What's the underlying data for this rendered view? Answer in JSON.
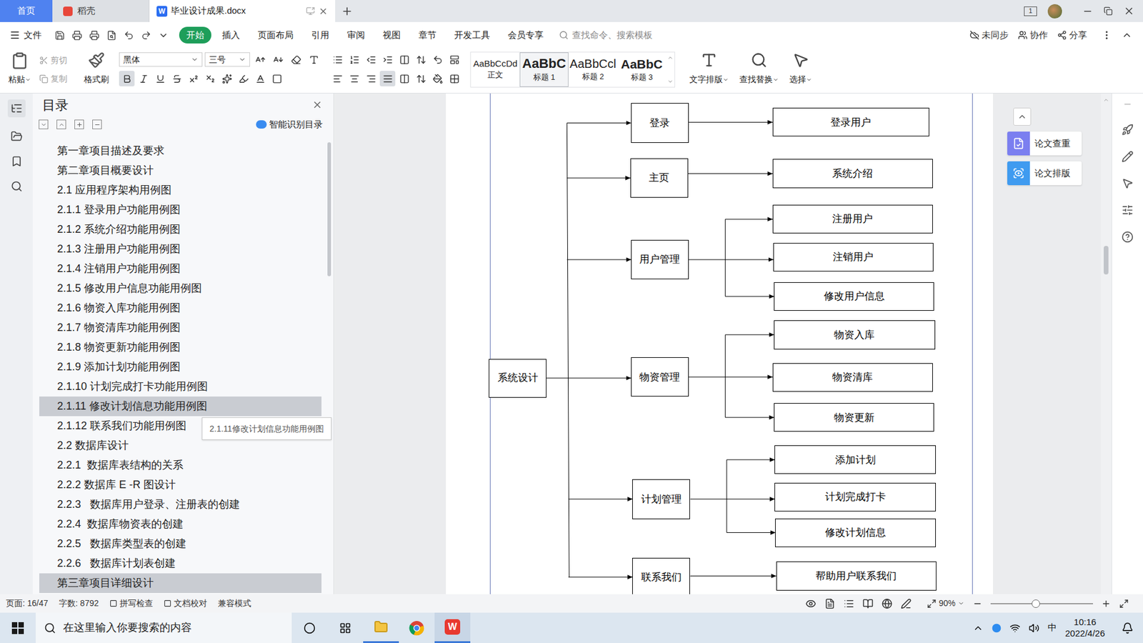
{
  "titlebar": {
    "tabs": [
      {
        "label": "首页",
        "kind": "home",
        "selected": false
      },
      {
        "label": "稻壳",
        "kind": "app",
        "selected": false
      },
      {
        "label": "毕业设计成果.docx",
        "kind": "doc",
        "selected": true
      }
    ],
    "doc_icon": "W",
    "window_count": "1"
  },
  "menu": {
    "file": "文件",
    "items": [
      {
        "label": "开始",
        "selected": true
      },
      {
        "label": "插入",
        "selected": false
      },
      {
        "label": "页面布局",
        "selected": false
      },
      {
        "label": "引用",
        "selected": false
      },
      {
        "label": "审阅",
        "selected": false
      },
      {
        "label": "视图",
        "selected": false
      },
      {
        "label": "章节",
        "selected": false
      },
      {
        "label": "开发工具",
        "selected": false
      },
      {
        "label": "会员专享",
        "selected": false
      }
    ],
    "search_placeholder": "查找命令、搜索模板",
    "right": [
      "未同步",
      "协作",
      "分享"
    ]
  },
  "ribbon": {
    "paste": "粘贴",
    "clipboard": [
      {
        "label": "剪切",
        "disabled": true
      },
      {
        "label": "复制",
        "disabled": true
      }
    ],
    "format_painter": "格式刷",
    "font": "黑体",
    "size": "三号",
    "bold": true,
    "justify": true,
    "styles": [
      {
        "preview": "AaBbCcDd",
        "label": "正文",
        "kind": "normal",
        "selected": false
      },
      {
        "preview": "AaBbC",
        "label": "标题 1",
        "kind": "h1",
        "selected": true
      },
      {
        "preview": "AaBbCcl",
        "label": "标题 2",
        "kind": "h2",
        "selected": false
      },
      {
        "preview": "AaBbC",
        "label": "标题 3",
        "kind": "h3",
        "selected": false
      }
    ],
    "tools": [
      "文字排版",
      "查找替换",
      "选择"
    ]
  },
  "toc": {
    "title": "目录",
    "smart": "智能识别目录",
    "items": [
      {
        "label": "第一章项目描述及要求",
        "highlighted": false
      },
      {
        "label": "第二章项目概要设计",
        "highlighted": false
      },
      {
        "label": "2.1 应用程序架构用例图",
        "highlighted": false
      },
      {
        "label": "2.1.1 登录用户功能用例图",
        "highlighted": false
      },
      {
        "label": "2.1.2 系统介绍功能用例图",
        "highlighted": false
      },
      {
        "label": "2.1.3 注册用户功能用例图",
        "highlighted": false
      },
      {
        "label": "2.1.4 注销用户功能用例图",
        "highlighted": false
      },
      {
        "label": "2.1.5 修改用户信息功能用例图",
        "highlighted": false
      },
      {
        "label": "2.1.6 物资入库功能用例图",
        "highlighted": false
      },
      {
        "label": "2.1.7 物资清库功能用例图",
        "highlighted": false
      },
      {
        "label": "2.1.8 物资更新功能用例图",
        "highlighted": false
      },
      {
        "label": "2.1.9 添加计划功能用例图",
        "highlighted": false
      },
      {
        "label": "2.1.10 计划完成打卡功能用例图",
        "highlighted": false
      },
      {
        "label": "2.1.11 修改计划信息功能用例图",
        "highlighted": true
      },
      {
        "label": "2.1.12 联系我们功能用例图",
        "highlighted": false
      },
      {
        "label": "2.2 数据库设计",
        "highlighted": false
      },
      {
        "label": "2.2.1  数据库表结构的关系",
        "highlighted": false
      },
      {
        "label": "2.2.2 数据库 E -R 图设计",
        "highlighted": false
      },
      {
        "label": "2.2.3   数据库用户登录、注册表的创建",
        "highlighted": false
      },
      {
        "label": "2.2.4  数据库物资表的创建",
        "highlighted": false
      },
      {
        "label": "2.2.5   数据库类型表的创建",
        "highlighted": false
      },
      {
        "label": "2.2.6   数据库计划表创建",
        "highlighted": false
      },
      {
        "label": "第三章项目详细设计",
        "highlighted": true
      }
    ],
    "tooltip": "2.1.11修改计划信息功能用例图"
  },
  "diagram": {
    "root": "系统设计",
    "branches": [
      {
        "label": "登录",
        "leaves": [
          "登录用户"
        ]
      },
      {
        "label": "主页",
        "leaves": [
          "系统介绍"
        ]
      },
      {
        "label": "用户管理",
        "leaves": [
          "注册用户",
          "注销用户",
          "修改用户信息"
        ]
      },
      {
        "label": "物资管理",
        "leaves": [
          "物资入库",
          "物资清库",
          "物资更新"
        ]
      },
      {
        "label": "计划管理",
        "leaves": [
          "添加计划",
          "计划完成打卡",
          "修改计划信息"
        ]
      },
      {
        "label": "联系我们",
        "leaves": [
          "帮助用户联系我们"
        ]
      }
    ]
  },
  "side_panel": [
    "论文查重",
    "论文排版"
  ],
  "status_bar": {
    "page": "页面: 16/47",
    "words": "字数: 8792",
    "checks": [
      "拼写检查",
      "文档校对"
    ],
    "mode": "兼容模式",
    "zoom": "90%",
    "zoom_level": 0.44
  },
  "taskbar": {
    "search_placeholder": "在这里输入你要搜索的内容",
    "ime": "中",
    "time": "10:16",
    "date": "2022/4/26"
  }
}
